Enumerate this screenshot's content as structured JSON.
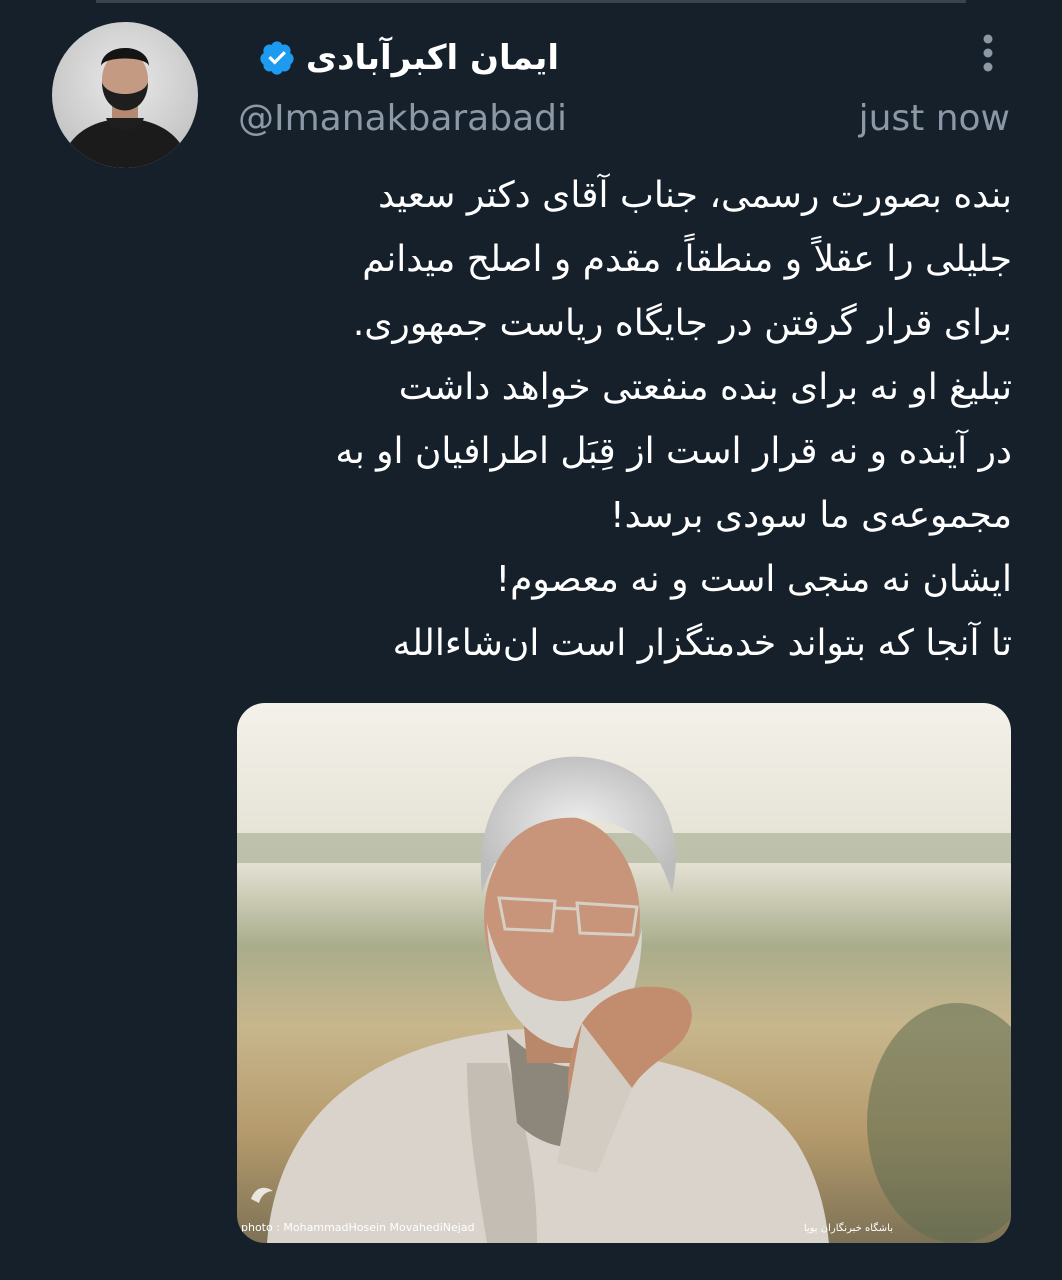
{
  "tweet": {
    "display_name": "ایمان اکبرآبادی",
    "handle": "@Imanakbarabadi",
    "timestamp": "just now",
    "text_lines": [
      "بنده بصورت رسمی، جناب آقای دکتر سعید",
      "جلیلی را عقلاً و منطقاً، مقدم و اصلح میدانم",
      "برای قرار گرفتن در جایگاه ریاست جمهوری.",
      "تبلیغ او نه برای بنده منفعتی خواهد داشت",
      "در آینده و نه قرار است از قِبَل اطرافیان او به",
      "مجموعه‌ی ما سودی برسد!",
      "ایشان نه منجی است و نه معصوم!",
      "تا آنجا که بتواند خدمتگزار است ان‌شاءالله"
    ],
    "media": {
      "photo_credit": "photo : MohammadHosein MovahediNejad",
      "agency_credit": "باشگاه خبرنگاران پویا"
    }
  },
  "icons": {
    "verified": "verified-badge-icon",
    "more": "more-options-icon"
  },
  "colors": {
    "background": "#15202b",
    "text_primary": "#ffffff",
    "text_secondary": "#8b98a5",
    "verified_blue": "#1d9bf0"
  }
}
